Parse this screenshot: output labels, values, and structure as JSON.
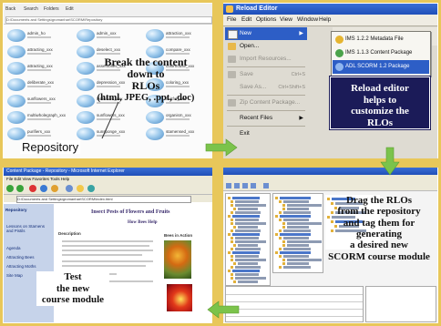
{
  "repository": {
    "toolbar_items": [
      "Back",
      "Search",
      "Folders",
      "Edit"
    ],
    "address": "D:\\Documents and Settings\\gromanhar\\SCORM\\Repository",
    "files": [
      {
        "name": "admin_ho"
      },
      {
        "name": "admin_xxx"
      },
      {
        "name": "attraction_xxx"
      },
      {
        "name": "attracting_xxx"
      },
      {
        "name": "deselect_xxx"
      },
      {
        "name": "compare_xxx"
      },
      {
        "name": "attracting_xxx"
      },
      {
        "name": "assemblies_xxx"
      },
      {
        "name": "colorhouse_xxx"
      },
      {
        "name": "deliberate_xxx"
      },
      {
        "name": "depression_xxx"
      },
      {
        "name": "coloring_xxx"
      },
      {
        "name": "sunflowers_xxx"
      },
      {
        "name": "leafcolors_xxx"
      },
      {
        "name": "fruitful_xxx"
      },
      {
        "name": "multiwholegraph_xxx"
      },
      {
        "name": "sunflowers_xxx"
      },
      {
        "name": "organism_xxx"
      },
      {
        "name": "purifiers_xxx"
      },
      {
        "name": "sunsponge_xxx"
      },
      {
        "name": "stamensed_xxx"
      }
    ],
    "callout": [
      "Break the content",
      "down to",
      "RLOs",
      "(html, JPEG, .ppt, .doc)"
    ],
    "caption": "Repository"
  },
  "editor": {
    "title": "Reload Editor",
    "menus": [
      "File",
      "Edit",
      "Options",
      "View",
      "Window",
      "Help"
    ],
    "file_menu": [
      {
        "label": "New",
        "state": "selected",
        "shortcut": ""
      },
      {
        "label": "Open...",
        "state": "normal",
        "shortcut": ""
      },
      {
        "label": "Import Resources...",
        "state": "disabled",
        "shortcut": ""
      },
      {
        "label": "Save",
        "state": "disabled",
        "shortcut": "Ctrl+S"
      },
      {
        "label": "Save As...",
        "state": "disabled",
        "shortcut": "Ctrl+Shift+S"
      },
      {
        "label": "Zip Content Package...",
        "state": "disabled",
        "shortcut": ""
      },
      {
        "label": "Recent Files",
        "state": "normal",
        "shortcut": ""
      },
      {
        "label": "Exit",
        "state": "normal",
        "shortcut": ""
      }
    ],
    "new_submenu": [
      "IMS 1.2.2 Metadata File",
      "IMS 1.1.3 Content Package",
      "ADL SCORM 1.2 Package"
    ],
    "callout": [
      "Reload editor",
      "helps to",
      "customize  the",
      "RLOs"
    ]
  },
  "browser": {
    "title": "Content Package - Repository - Microsoft Internet Explorer",
    "menu": "File  Edit  View  Favorites  Tools  Help",
    "address": "D:\\Documents and Settings\\gromanhar\\SCORM\\index.html",
    "nav_heading": "Repository",
    "nav_items": [
      "Lessons on Stamens and Pistils",
      "Agenda",
      "Attracting Bees",
      "Attracting Moths",
      "Site Map"
    ],
    "page_title": "Insect Pests of Flowers and Fruits",
    "page_subtitle": "How Bees Help",
    "section_labels": [
      "Description",
      "Bees in Action"
    ],
    "callout": [
      "Test",
      "the new",
      "course module"
    ]
  },
  "tagger": {
    "callout": [
      "Drag the RLOs",
      "from the repository",
      "and tag them for",
      "generating",
      "a desired new",
      "SCORM course module"
    ]
  },
  "colors": {
    "frame": "#e8c75a",
    "arrow": "#7bc34b",
    "editor_callout_bg": "#1b1b58",
    "menu_selection": "#2d5ec6"
  }
}
